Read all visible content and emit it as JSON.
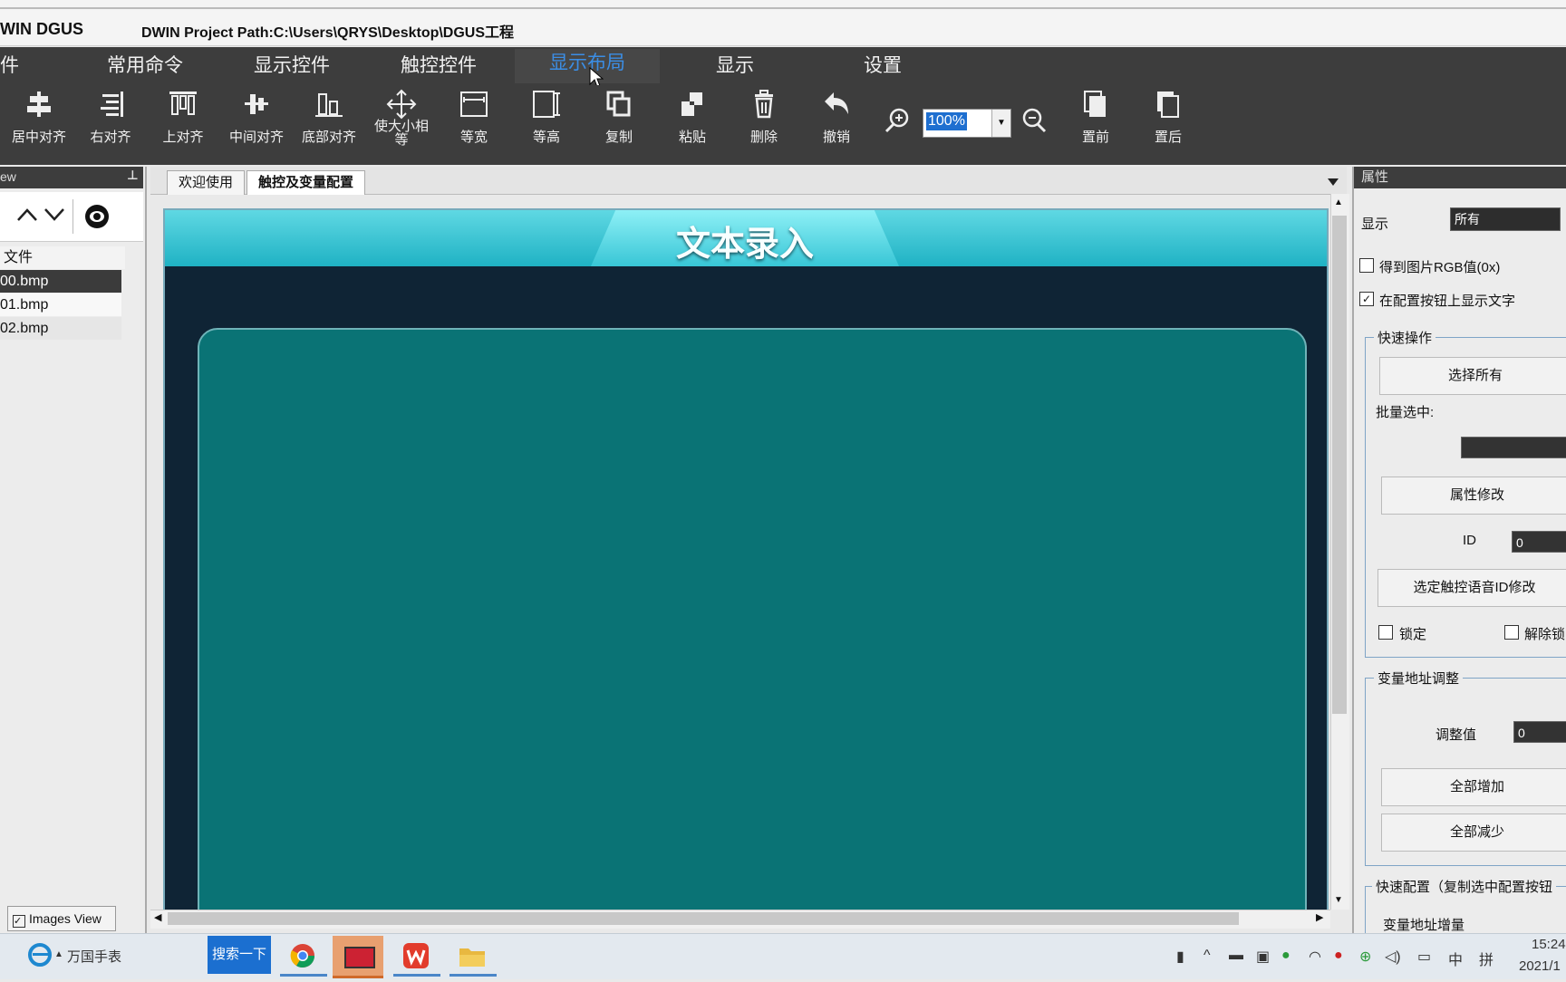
{
  "window": {
    "app_name": "WIN DGUS",
    "project_path": "DWIN Project Path:C:\\Users\\QRYS\\Desktop\\DGUS工程"
  },
  "menu": {
    "items": [
      "件",
      "常用命令",
      "显示控件",
      "触控控件",
      "显示布局",
      "显示",
      "设置"
    ],
    "active": "显示布局"
  },
  "toolbar": {
    "tools": [
      {
        "label": "居中对齐",
        "icon": "align-center-icon"
      },
      {
        "label": "右对齐",
        "icon": "align-right-icon"
      },
      {
        "label": "上对齐",
        "icon": "align-top-icon"
      },
      {
        "label": "中间对齐",
        "icon": "align-middle-icon"
      },
      {
        "label": "底部对齐",
        "icon": "align-bottom-icon"
      },
      {
        "label": "使大小相等",
        "icon": "same-size-icon"
      },
      {
        "label": "等宽",
        "icon": "same-width-icon"
      },
      {
        "label": "等高",
        "icon": "same-height-icon"
      },
      {
        "label": "复制",
        "icon": "copy-icon"
      },
      {
        "label": "粘贴",
        "icon": "paste-icon"
      },
      {
        "label": "删除",
        "icon": "delete-icon"
      },
      {
        "label": "撤销",
        "icon": "undo-icon"
      },
      {
        "label": "置前",
        "icon": "bring-front-icon"
      },
      {
        "label": "置后",
        "icon": "send-back-icon"
      }
    ],
    "zoom_value": "100%"
  },
  "left_panel": {
    "header": "ew",
    "pin": "ᵖ",
    "list_header": "文件",
    "files": [
      "00.bmp",
      "01.bmp",
      "02.bmp"
    ],
    "selected_file": "00.bmp",
    "images_view_label": "Images View"
  },
  "tabs": [
    {
      "label": "欢迎使用",
      "active": false
    },
    {
      "label": "触控及变量配置",
      "active": true
    }
  ],
  "canvas": {
    "title": "文本录入"
  },
  "properties": {
    "header": "属性",
    "display_label": "显示",
    "display_value": "所有",
    "get_rgb_label": "得到图片RGB值(0x)",
    "get_rgb_checked": false,
    "show_text_label": "在配置按钮上显示文字",
    "show_text_checked": true,
    "quick_ops_title": "快速操作",
    "select_all_button": "选择所有",
    "batch_select_label": "批量选中:",
    "modify_props_button": "属性修改",
    "id_label": "ID",
    "id_value": "0",
    "voice_id_button": "选定触控语音ID修改",
    "lock_label": "锁定",
    "unlock_label": "解除锁",
    "var_addr_title": "变量地址调整",
    "adjust_label": "调整值",
    "adjust_value": "0",
    "add_all_button": "全部增加",
    "sub_all_button": "全部减少",
    "quick_config_title": "快速配置（复制选中配置按钮",
    "var_increment_label": "变量地址增量"
  },
  "taskbar": {
    "weather_label": "万国手表",
    "search_button": "搜索一下",
    "ime_mode": "中",
    "ime_name": "拼",
    "time": "15:24",
    "date": "2021/1"
  },
  "colors": {
    "menu_bg": "#3d3d3d",
    "menu_active_text": "#3b8ee6",
    "canvas_teal": "#0a7375",
    "banner_cyan": "#1fb2c4"
  }
}
